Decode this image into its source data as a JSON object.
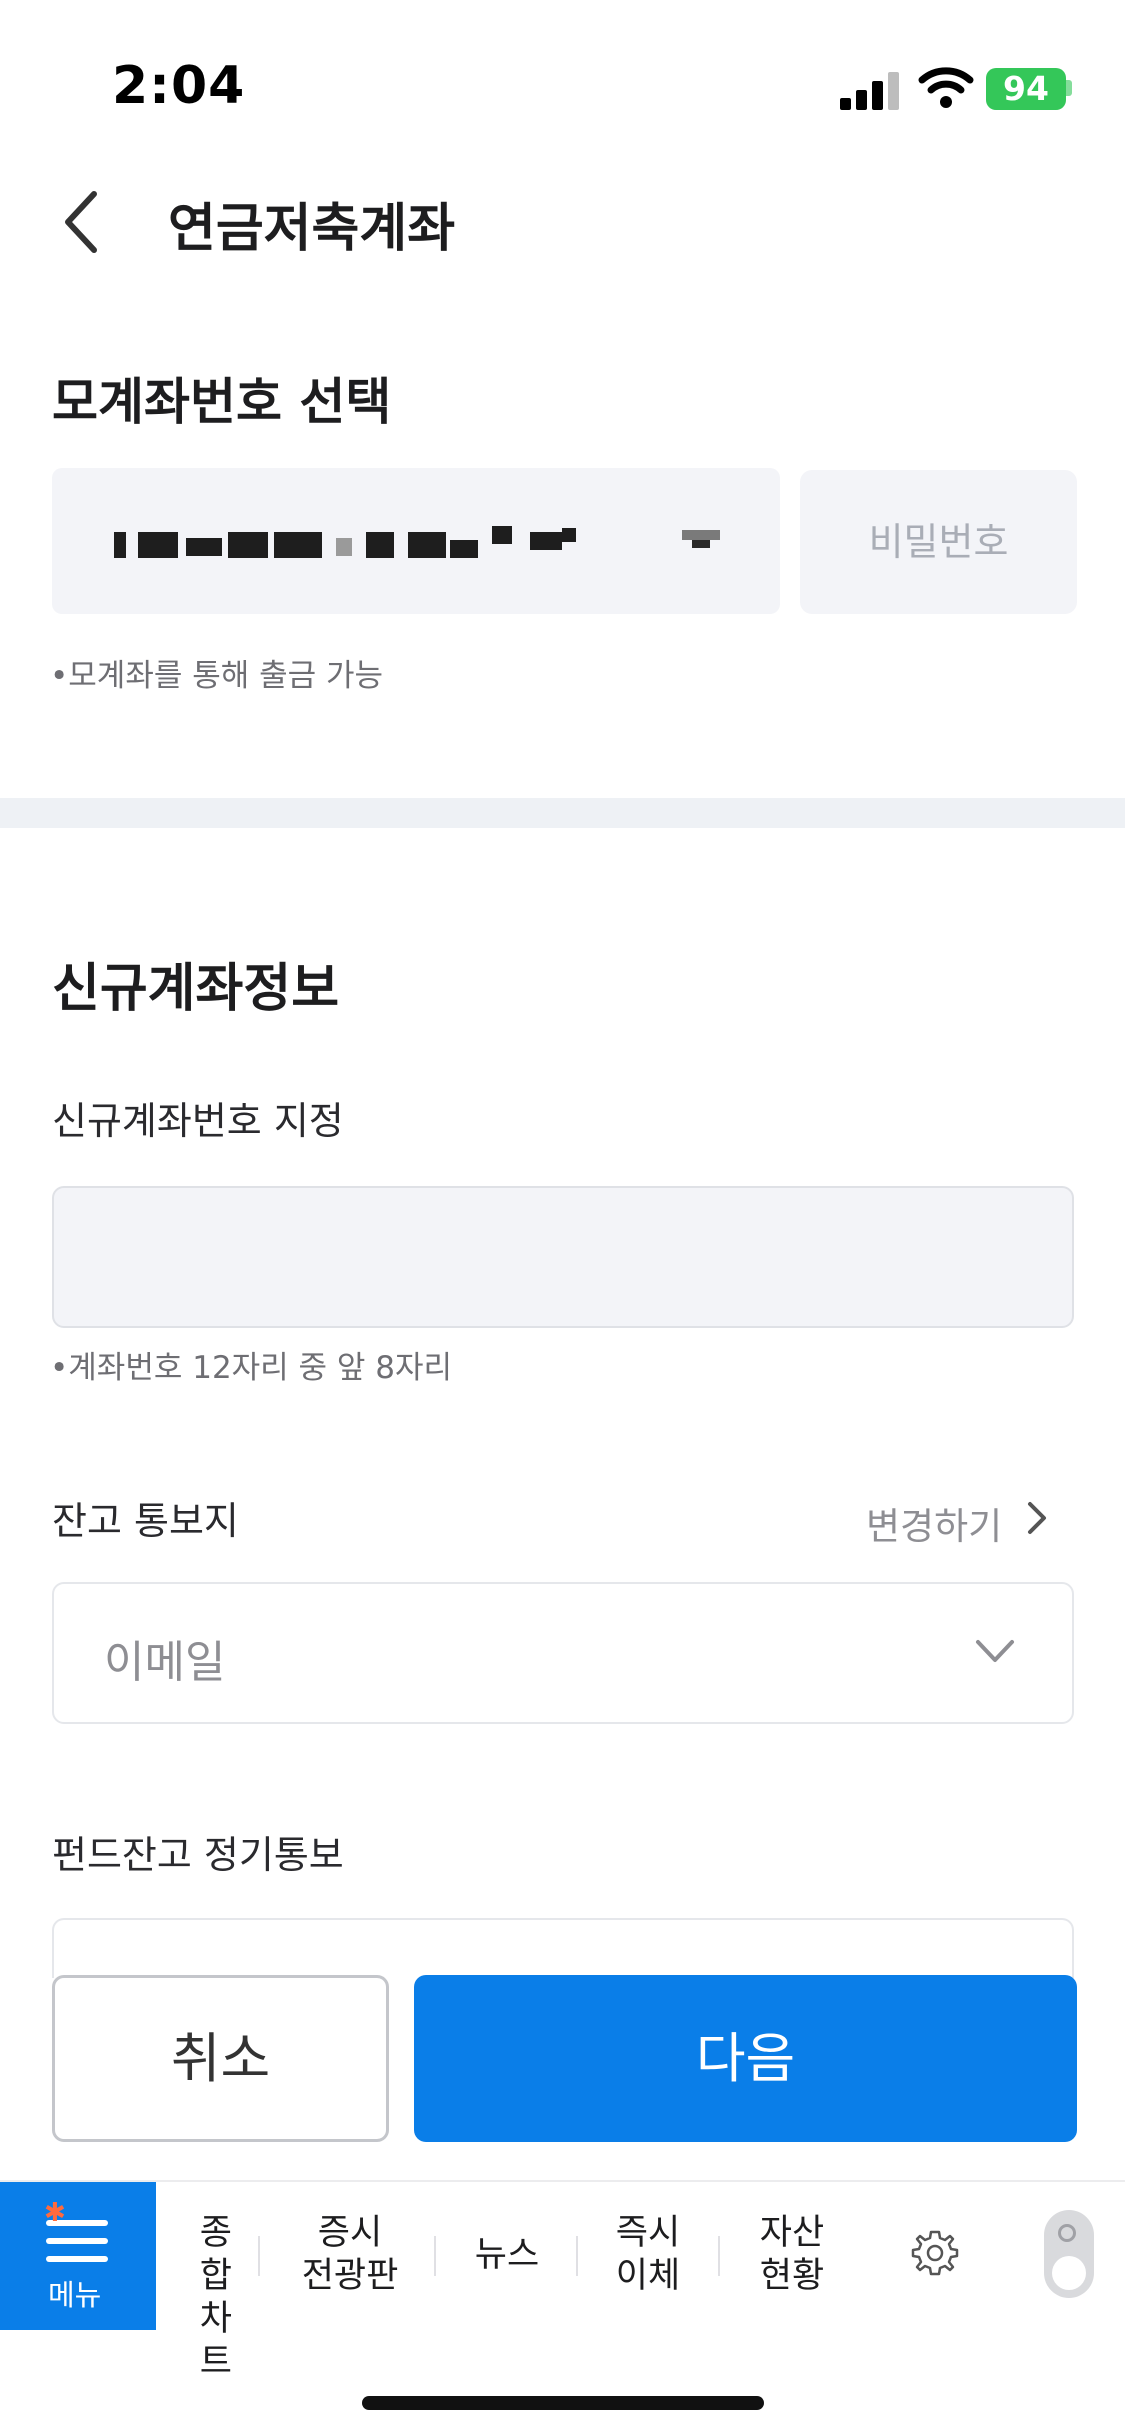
{
  "status_bar": {
    "time": "2:04",
    "battery": "94"
  },
  "header": {
    "title": "연금저축계좌"
  },
  "parent_account": {
    "section_title": "모계좌번호 선택",
    "password_placeholder": "비밀번호",
    "note": "•모계좌를 통해 출금 가능"
  },
  "new_account": {
    "section_title": "신규계좌정보",
    "number_label": "신규계좌번호 지정",
    "number_value": "",
    "number_note": "•계좌번호 12자리 중 앞 8자리",
    "notice_label": "잔고 통보지",
    "change_link": "변경하기",
    "notice_value": "이메일",
    "fund_notice_label": "펀드잔고 정기통보"
  },
  "buttons": {
    "cancel": "취소",
    "next": "다음"
  },
  "bottom_nav": {
    "menu": "메뉴",
    "items": [
      {
        "l1": "종합",
        "l2": "차트"
      },
      {
        "l1": "증시",
        "l2": "전광판"
      },
      {
        "l1": "뉴스",
        "l2": ""
      },
      {
        "l1": "즉시",
        "l2": "이체"
      },
      {
        "l1": "자산",
        "l2": "현황"
      }
    ]
  },
  "colors": {
    "primary": "#0a7ee8",
    "battery": "#34c759",
    "input_bg": "#f3f4f8"
  },
  "icons": [
    "back-chevron-icon",
    "signal-icon",
    "wifi-icon",
    "battery-icon",
    "chevron-down-icon",
    "chevron-right-icon",
    "menu-icon",
    "gear-icon",
    "toggle-icon"
  ]
}
